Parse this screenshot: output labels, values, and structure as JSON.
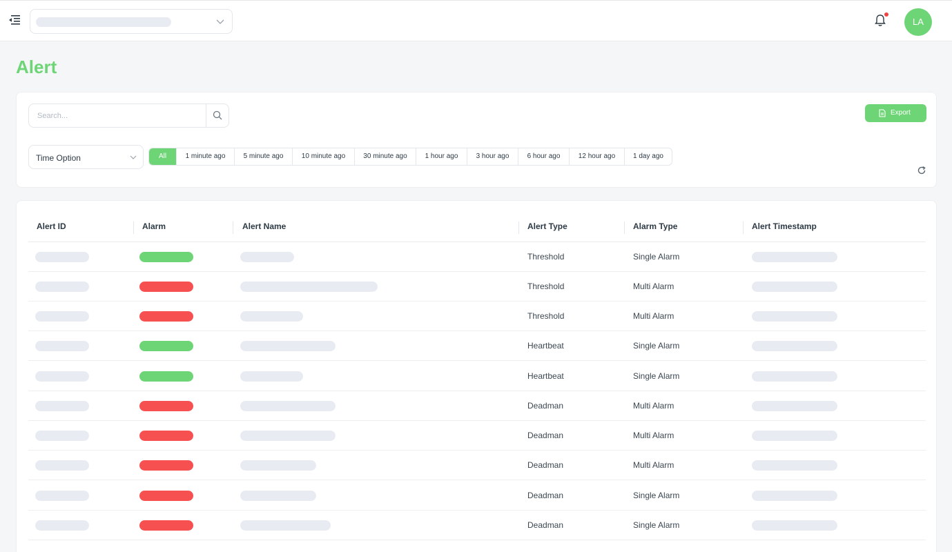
{
  "header": {
    "avatar_initials": "LA",
    "has_notification": true,
    "icons": [
      "menu-toggle-icon",
      "chevron-down-icon",
      "bell-icon"
    ]
  },
  "page": {
    "title": "Alert"
  },
  "filters": {
    "search_placeholder": "Search...",
    "export_label": "Export",
    "time_option_label": "Time Option",
    "time_tabs": [
      "All",
      "1 minute ago",
      "5 minute ago",
      "10 minute ago",
      "30 minute ago",
      "1 hour ago",
      "3 hour ago",
      "6 hour ago",
      "12 hour ago",
      "1 day ago"
    ],
    "active_tab": "All"
  },
  "table": {
    "columns": [
      "Alert ID",
      "Alarm",
      "Alert Name",
      "Alert Type",
      "Alarm Type",
      "Alert Timestamp"
    ],
    "rows": [
      {
        "alarm": "green",
        "alert_type": "Threshold",
        "alarm_type": "Single Alarm"
      },
      {
        "alarm": "red",
        "alert_type": "Threshold",
        "alarm_type": "Multi Alarm"
      },
      {
        "alarm": "red",
        "alert_type": "Threshold",
        "alarm_type": "Multi Alarm"
      },
      {
        "alarm": "green",
        "alert_type": "Heartbeat",
        "alarm_type": "Single Alarm"
      },
      {
        "alarm": "green",
        "alert_type": "Heartbeat",
        "alarm_type": "Single Alarm"
      },
      {
        "alarm": "red",
        "alert_type": "Deadman",
        "alarm_type": "Multi Alarm"
      },
      {
        "alarm": "red",
        "alert_type": "Deadman",
        "alarm_type": "Multi Alarm"
      },
      {
        "alarm": "red",
        "alert_type": "Deadman",
        "alarm_type": "Multi Alarm"
      },
      {
        "alarm": "red",
        "alert_type": "Deadman",
        "alarm_type": "Single Alarm"
      },
      {
        "alarm": "red",
        "alert_type": "Deadman",
        "alarm_type": "Single Alarm"
      }
    ]
  },
  "colors": {
    "accent": "#6dd576",
    "alarm_green": "#6dd576",
    "alarm_red": "#f75050",
    "skeleton": "#e8ecf2"
  }
}
